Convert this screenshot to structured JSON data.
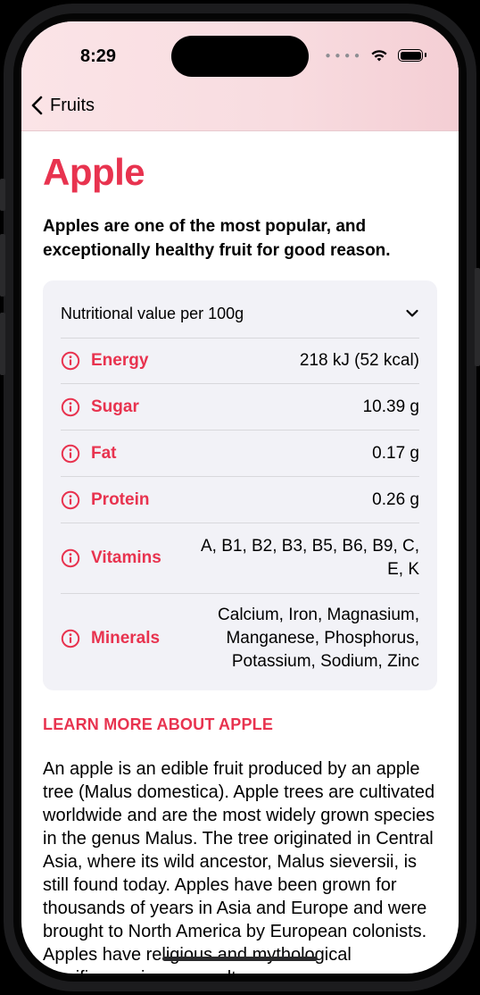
{
  "status_bar": {
    "time": "8:29",
    "cellular_icon": "signal-dots",
    "wifi_icon": "wifi-icon",
    "battery_icon": "battery-icon"
  },
  "nav": {
    "back_label": "Fruits"
  },
  "fruit": {
    "name": "Apple",
    "headline": "Apples are one of the most popular, and exceptionally healthy fruit for good reason.",
    "nutrition_title": "Nutritional value per 100g",
    "nutrients": [
      {
        "label": "Energy",
        "value": "218 kJ (52 kcal)"
      },
      {
        "label": "Sugar",
        "value": "10.39 g"
      },
      {
        "label": "Fat",
        "value": "0.17 g"
      },
      {
        "label": "Protein",
        "value": "0.26 g"
      },
      {
        "label": "Vitamins",
        "value": "A, B1, B2, B3, B5, B6, B9, C, E, K"
      },
      {
        "label": "Minerals",
        "value": "Calcium, Iron, Magnasium, Manganese, Phosphorus, Potassium, Sodium, Zinc"
      }
    ],
    "learn_more_title": "LEARN MORE ABOUT APPLE",
    "description": "An apple is an edible fruit produced by an apple tree (Malus domestica). Apple trees are cultivated worldwide and are the most widely grown species in the genus Malus. The tree originated in Central Asia, where its wild ancestor, Malus sieversii, is still found today. Apples have been grown for thousands of years in Asia and Europe and were brought to North America by European colonists. Apples have religious and mythological significance in many cultures."
  },
  "colors": {
    "accent": "#e8334f",
    "card_bg": "#f2f2f7",
    "header_bg": "#f8dce0"
  }
}
